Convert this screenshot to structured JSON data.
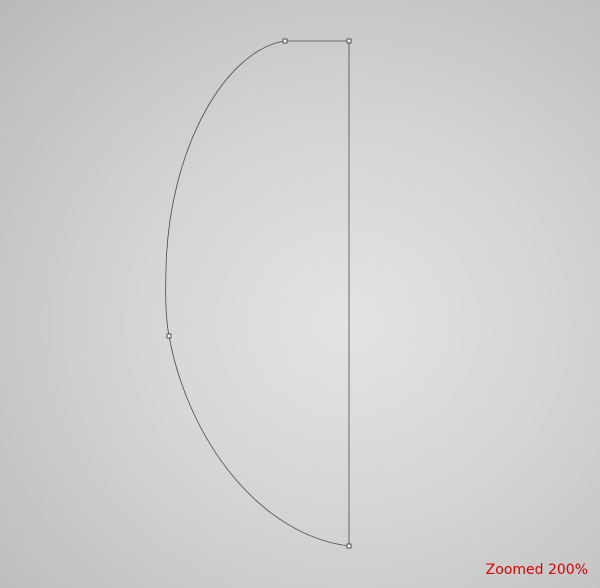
{
  "zoom_label": "Zoomed 200%",
  "colors": {
    "path_stroke": "#4a4a4a",
    "zoom_label": "#e00000",
    "anchor_fill": "#f4f4f4"
  },
  "icons": [
    "anchor-point-icon"
  ]
}
